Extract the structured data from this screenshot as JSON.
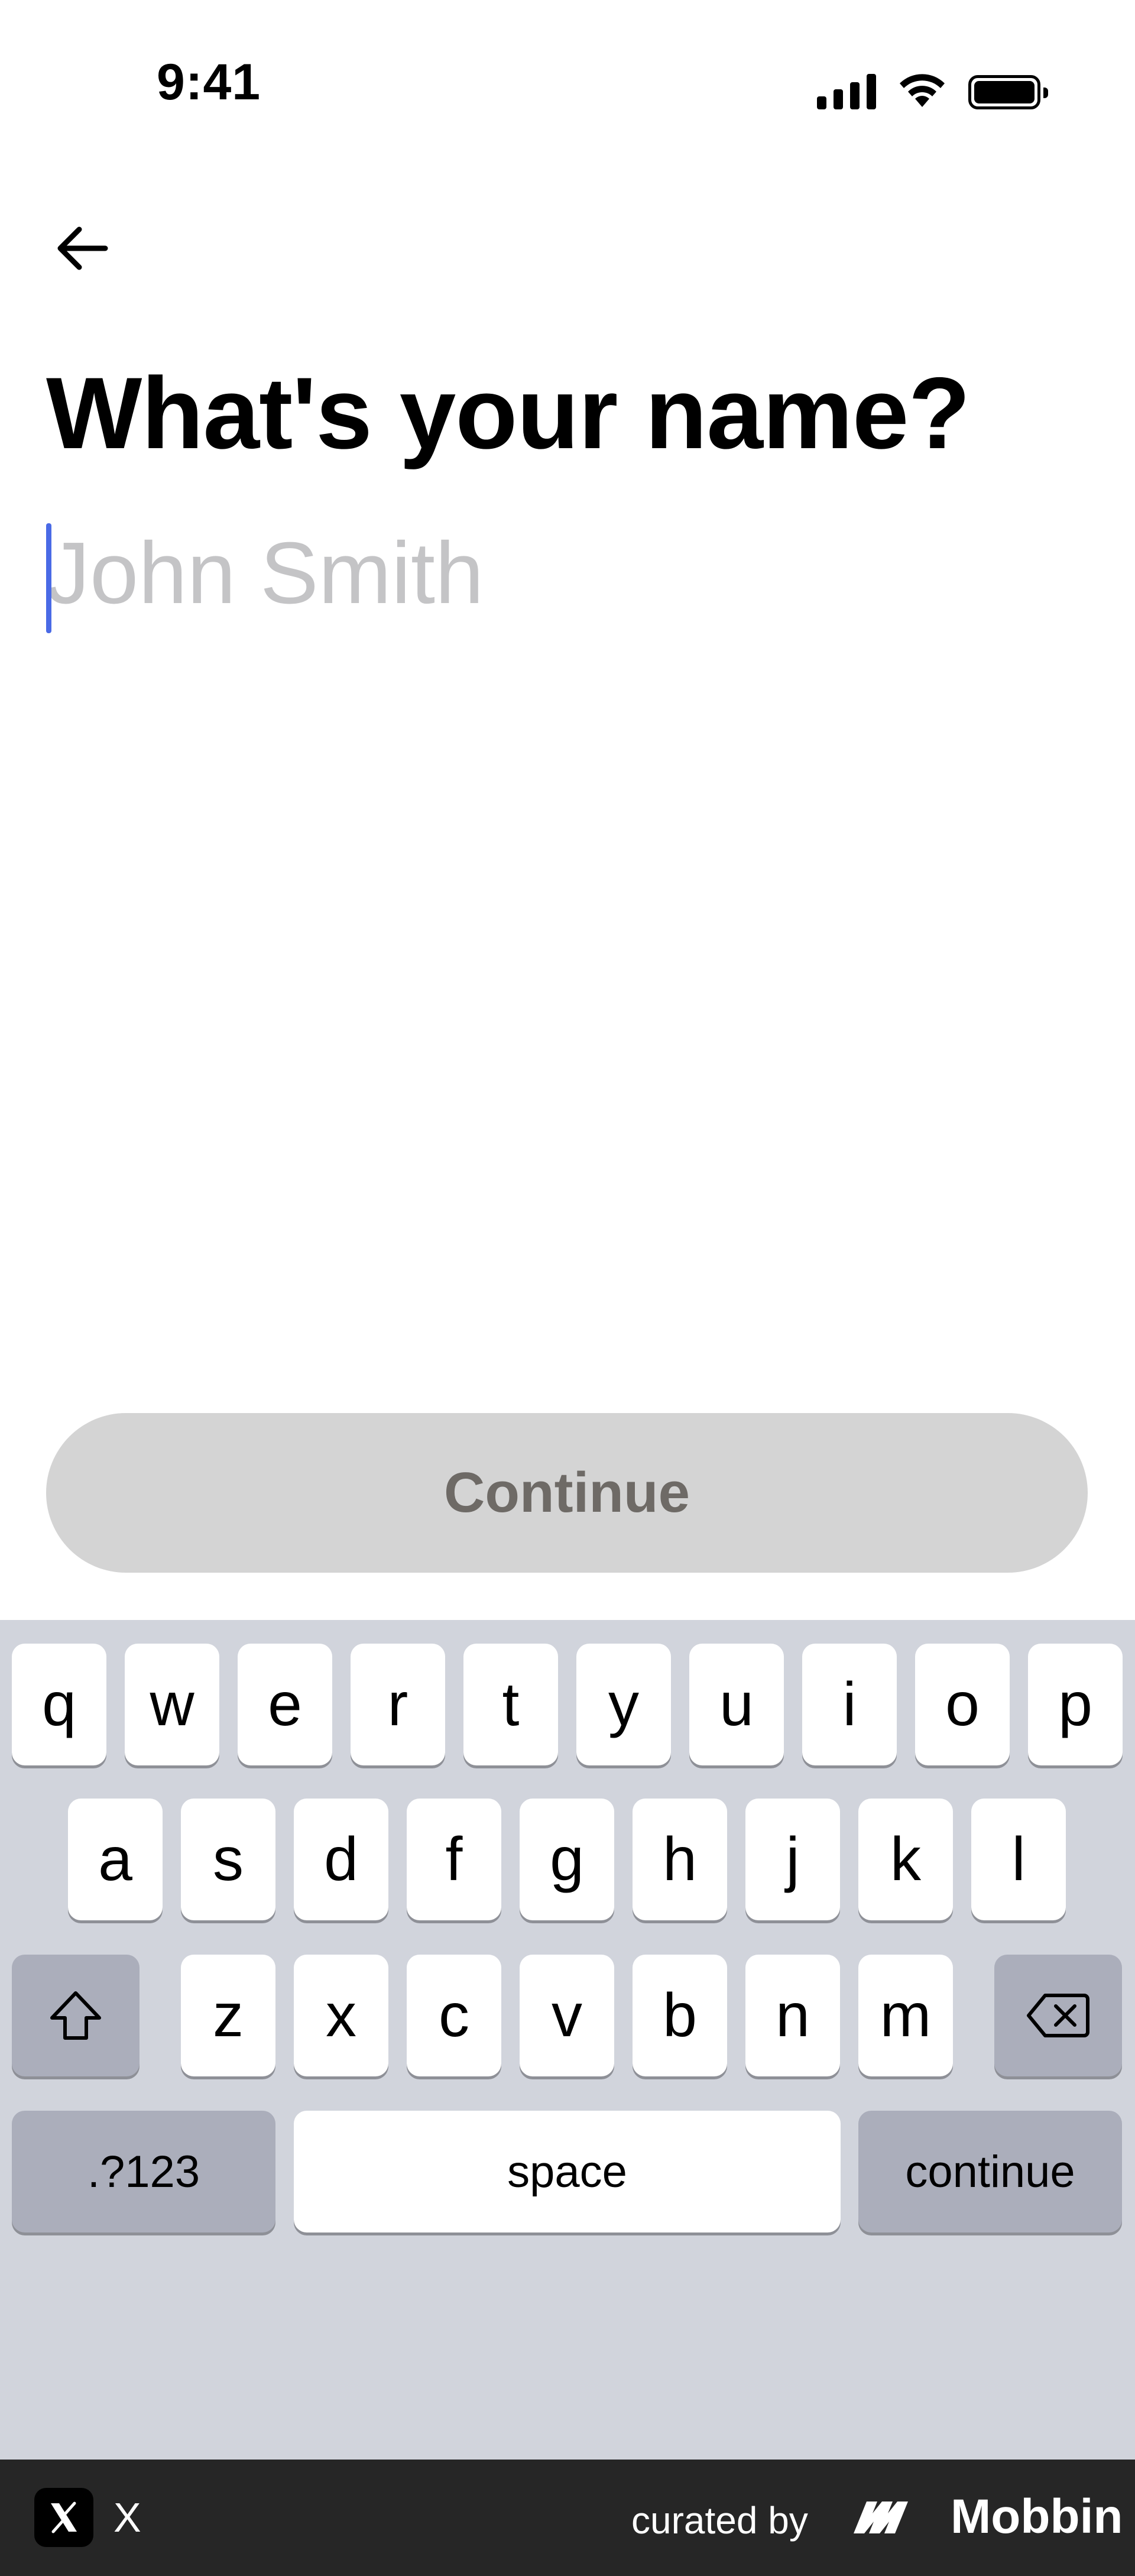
{
  "status_bar": {
    "time": "9:41",
    "icons": [
      "cellular-signal-icon",
      "wifi-icon",
      "battery-icon"
    ]
  },
  "header": {
    "back_icon": "arrow-left-icon"
  },
  "main": {
    "title": "What's your name?",
    "name_input": {
      "value": "",
      "placeholder": "John Smith"
    },
    "continue_label": "Continue"
  },
  "keyboard": {
    "row1": [
      "q",
      "w",
      "e",
      "r",
      "t",
      "y",
      "u",
      "i",
      "o",
      "p"
    ],
    "row2": [
      "a",
      "s",
      "d",
      "f",
      "g",
      "h",
      "j",
      "k",
      "l"
    ],
    "row3": [
      "z",
      "x",
      "c",
      "v",
      "b",
      "n",
      "m"
    ],
    "shift_icon": "shift-arrow-icon",
    "delete_icon": "backspace-icon",
    "numbers_label": ".?123",
    "space_label": "space",
    "return_label": "continue"
  },
  "footer": {
    "app_icon": "x-logo-icon",
    "app_name": "X",
    "curated_label": "curated by",
    "brand_name": "Mobbin",
    "brand_icon": "mobbin-logo-icon"
  },
  "colors": {
    "caret": "#4a6ae6",
    "placeholder": "#c4c4c6",
    "button_disabled_bg": "#d4d4d4",
    "button_disabled_text": "#6e6a66",
    "keyboard_bg": "#d1d4dc",
    "key_dark": "#abaebb",
    "footer_bg": "#262626"
  }
}
